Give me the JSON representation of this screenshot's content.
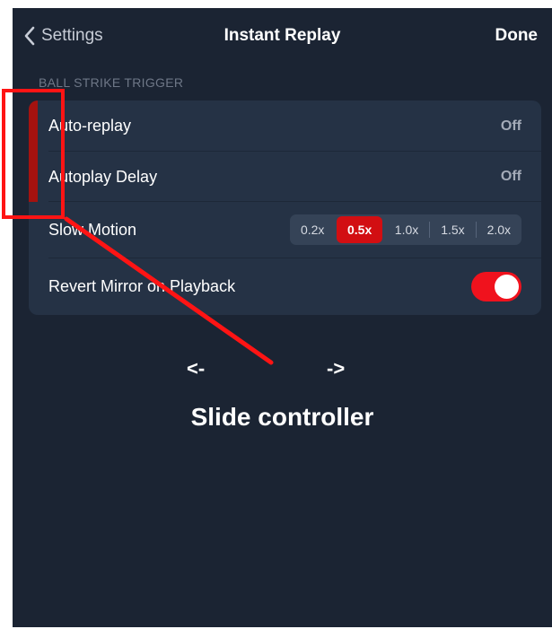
{
  "nav": {
    "back_label": "Settings",
    "title": "Instant Replay",
    "done_label": "Done"
  },
  "section": {
    "header": "BALL STRIKE TRIGGER"
  },
  "rows": {
    "auto_replay": {
      "label": "Auto-replay",
      "value": "Off"
    },
    "autoplay_delay": {
      "label": "Autoplay Delay",
      "value": "Off"
    },
    "slow_motion": {
      "label": "Slow Motion",
      "options": [
        "0.2x",
        "0.5x",
        "1.0x",
        "1.5x",
        "2.0x"
      ],
      "selected": "0.5x"
    },
    "revert_mirror": {
      "label": "Revert Mirror on Playback",
      "enabled": true
    }
  },
  "annotation": {
    "arrow_left": "<-",
    "arrow_right": "->",
    "caption": "Slide controller"
  },
  "colors": {
    "background": "#1b2433",
    "group": "#253245",
    "accent_red": "#d20e12",
    "toggle_on": "#f0121d",
    "annotation_red": "#ff1414"
  }
}
